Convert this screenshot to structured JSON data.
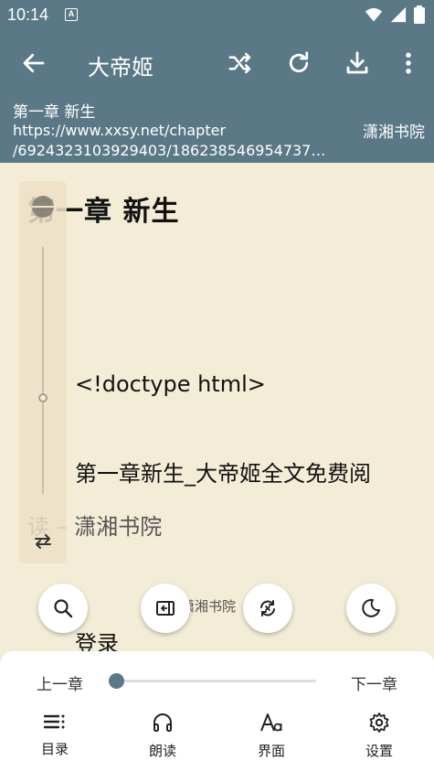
{
  "status_bar": {
    "time": "10:14",
    "notification_icon": "A",
    "icons": [
      "wifi-icon",
      "signal-icon",
      "battery-icon"
    ]
  },
  "toolbar": {
    "title": "大帝姬",
    "icons": [
      "back-arrow-icon",
      "shuffle-icon",
      "refresh-icon",
      "download-icon",
      "more-vert-icon"
    ]
  },
  "info": {
    "chapter": "第一章 新生",
    "url": "https://www.xxsy.net/chapter\n/6924323103929403/186238546954737…",
    "source": "潇湘书院"
  },
  "content": {
    "chapter_title": "第一章 新生",
    "title_overlay_prefix": "第",
    "paragraphs": [
      "<!doctype html>",
      "第一章新生_大帝姬全文免费阅",
      "读 – 潇湘书院",
      "登录"
    ],
    "faint_text": "潇湘书院"
  },
  "floating_buttons": [
    "search-icon",
    "auto-page-icon",
    "replace-icon",
    "night-mode-icon"
  ],
  "bottom": {
    "prev_label": "上一章",
    "next_label": "下一章",
    "progress": 0,
    "nav": [
      {
        "label": "目录",
        "icon": "list-icon"
      },
      {
        "label": "朗读",
        "icon": "headphones-icon"
      },
      {
        "label": "界面",
        "icon": "font-icon"
      },
      {
        "label": "设置",
        "icon": "gear-icon"
      }
    ]
  },
  "colors": {
    "header": "#5b7887",
    "page_background": "#f3ecd6",
    "accent": "#5b7887"
  }
}
